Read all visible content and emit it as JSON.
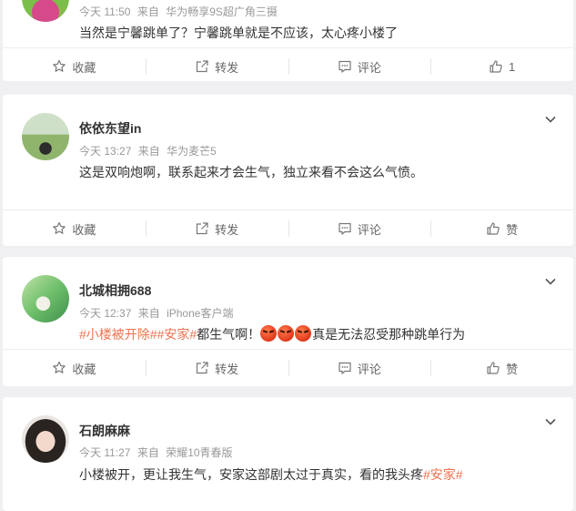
{
  "posts": [
    {
      "meta_time": "今天 11:50",
      "meta_from": "来自",
      "meta_device": "华为畅享9S超广角三摄",
      "text": "当然是宁馨跳单了？宁馨跳单就是不应该，太心疼小楼了",
      "actions": {
        "collect": "收藏",
        "forward": "转发",
        "comment": "评论",
        "like": "1"
      }
    },
    {
      "username": "依依东望in",
      "meta_time": "今天 13:27",
      "meta_from": "来自",
      "meta_device": "华为麦芒5",
      "text": "这是双响炮啊，联系起来才会生气，独立来看不会这么气愤。",
      "actions": {
        "collect": "收藏",
        "forward": "转发",
        "comment": "评论",
        "like": "赞"
      }
    },
    {
      "username": "北城相拥688",
      "meta_time": "今天 12:37",
      "meta_from": "来自",
      "meta_device": "iPhone客户端",
      "tag1": "#小楼被开除#",
      "tag2": "#安家#",
      "text_mid": "都生气啊！",
      "text_end": "真是无法忍受那种跳单行为",
      "actions": {
        "collect": "收藏",
        "forward": "转发",
        "comment": "评论",
        "like": "赞"
      }
    },
    {
      "username": "石朗麻麻",
      "meta_time": "今天 11:27",
      "meta_from": "来自",
      "meta_device": "荣耀10青春版",
      "text": "小楼被开，更让我生气，安家这部剧太过于真实，看的我头疼",
      "tag": "#安家#"
    }
  ],
  "colors": {
    "tag": "#eb7350",
    "background": "#f0f0f2"
  },
  "icons": {
    "collect": "star-outline-icon",
    "forward": "share-box-icon",
    "comment": "comment-bubble-icon",
    "like": "thumbs-up-icon",
    "more": "chevron-down-icon"
  }
}
